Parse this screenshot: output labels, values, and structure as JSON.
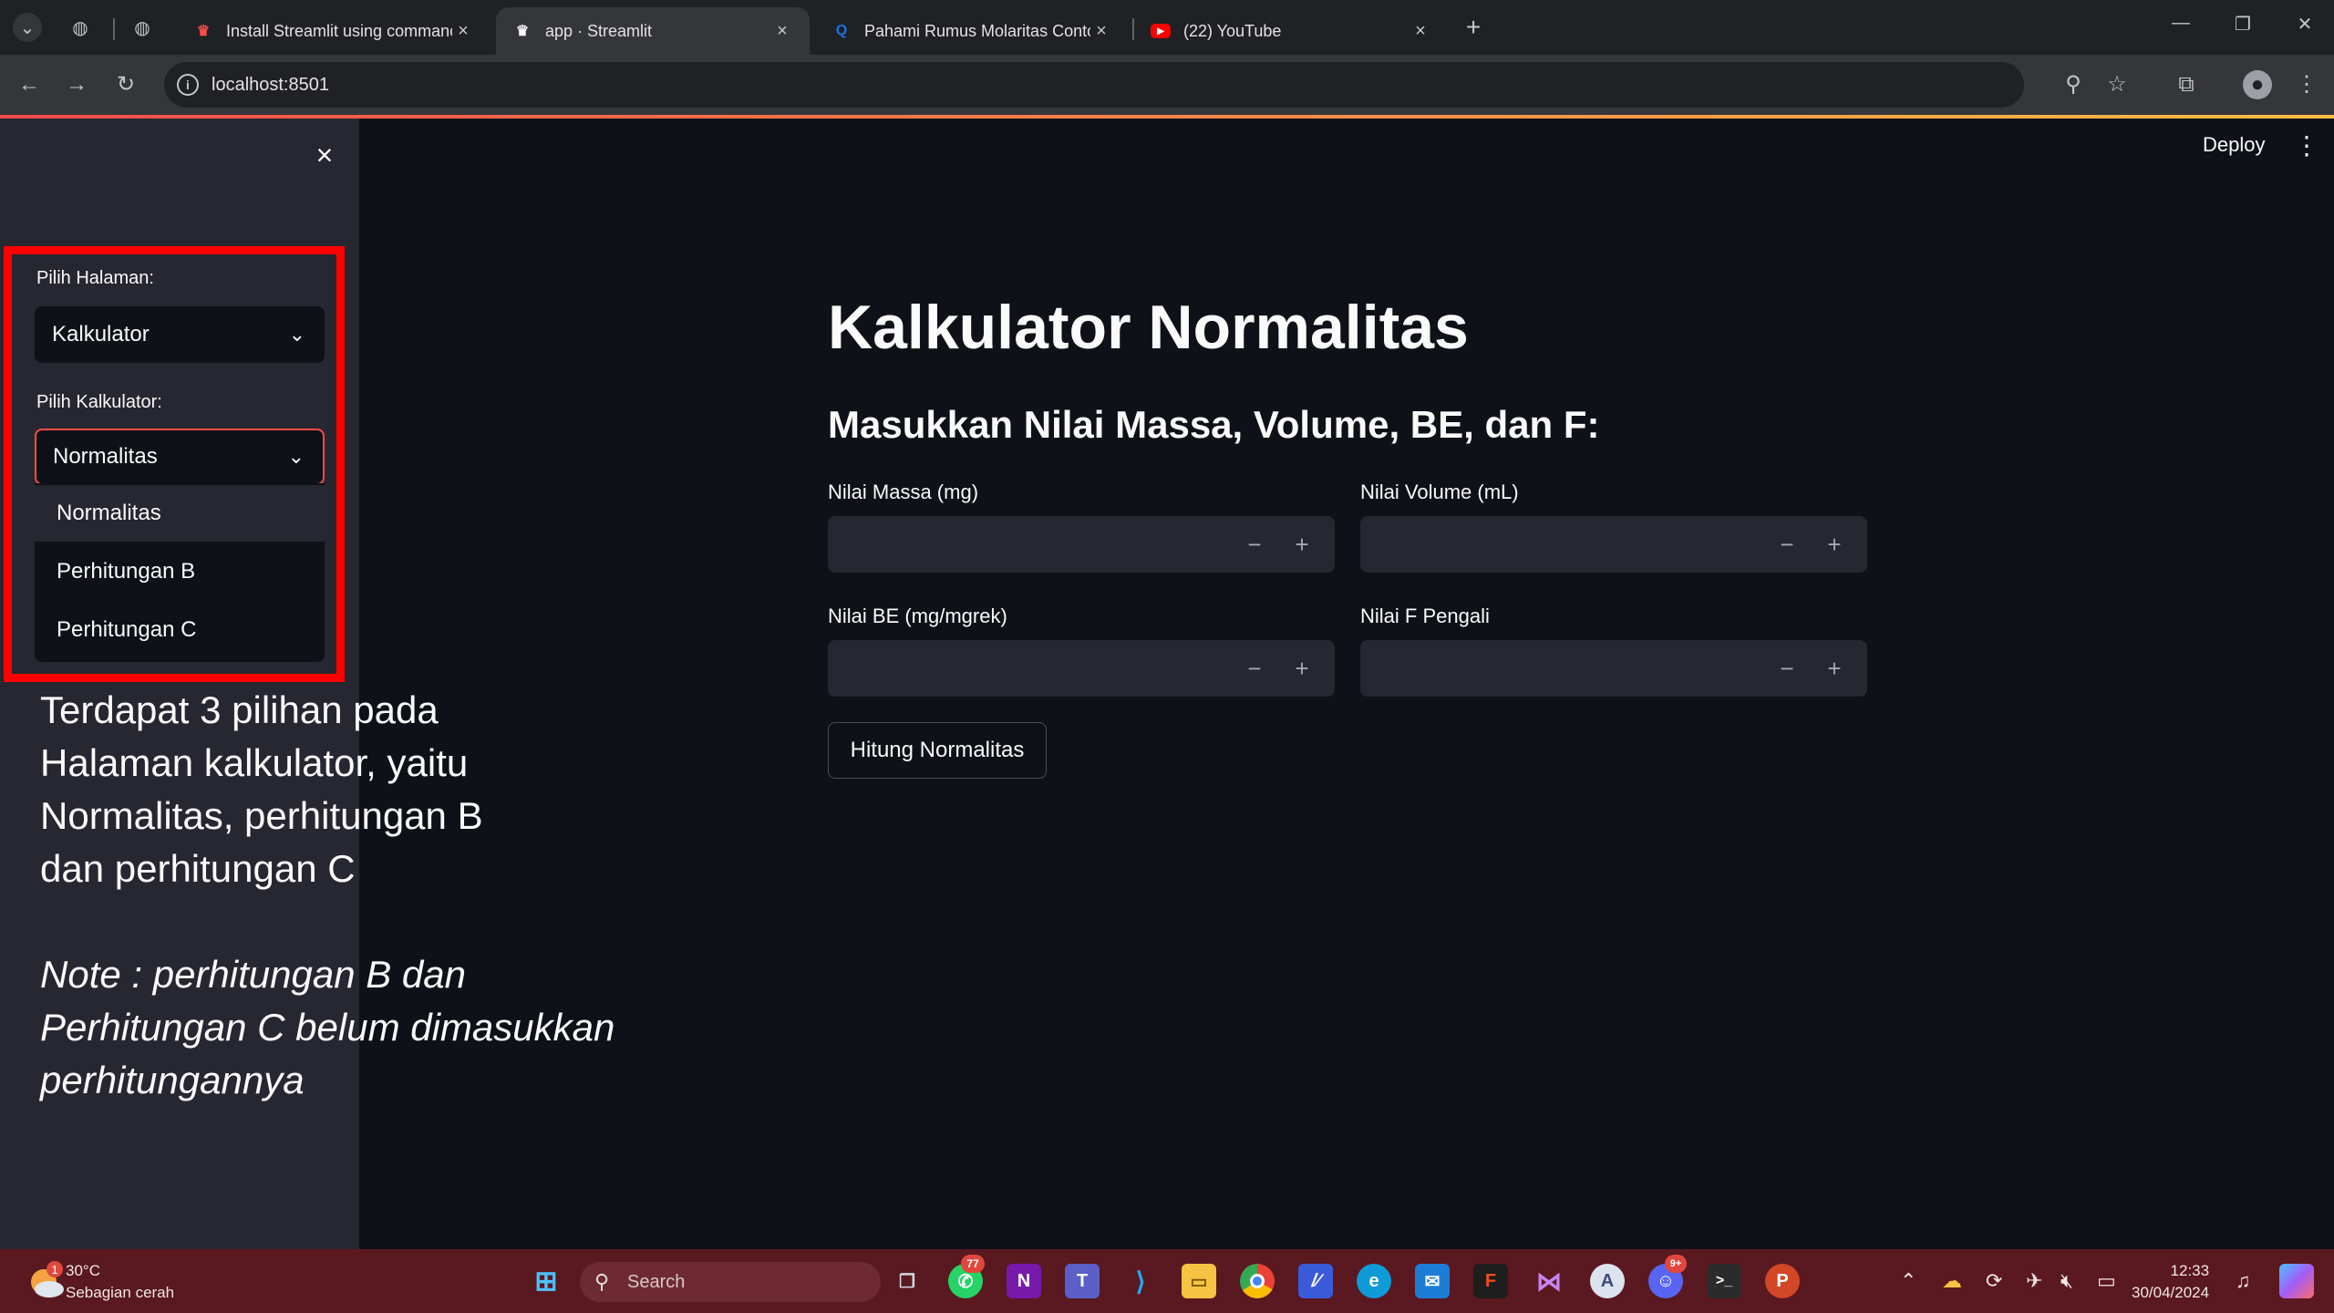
{
  "browser": {
    "tabs": [
      {
        "title": "Install Streamlit using commanc",
        "favicon": "streamlit-icon",
        "favicon_color": "#ff4b4b"
      },
      {
        "title": "app · Streamlit",
        "favicon": "streamlit-icon",
        "favicon_color": "#ff4b4b"
      },
      {
        "title": "Pahami Rumus Molaritas Conto",
        "favicon": "q-icon",
        "favicon_color": "#1a73e8"
      },
      {
        "title": "(22) YouTube",
        "favicon": "youtube-icon",
        "favicon_color": "#ff0000"
      }
    ],
    "url": "localhost:8501"
  },
  "header": {
    "deploy_label": "Deploy"
  },
  "sidebar": {
    "page_label": "Pilih Halaman:",
    "page_value": "Kalkulator",
    "calc_label": "Pilih Kalkulator:",
    "calc_value": "Normalitas",
    "calc_options": [
      "Normalitas",
      "Perhitungan B",
      "Perhitungan C"
    ]
  },
  "annotation": {
    "description_lines": [
      "Terdapat 3 pilihan pada",
      "Halaman kalkulator, yaitu",
      "Normalitas, perhitungan B",
      "dan perhitungan C"
    ],
    "note_lines": [
      "Note : perhitungan B dan",
      "Perhitungan C belum dimasukkan",
      "perhitungannya"
    ]
  },
  "main": {
    "title": "Kalkulator Normalitas",
    "subtitle": "Masukkan Nilai Massa, Volume, BE, dan F:",
    "fields": [
      {
        "label": "Nilai Massa (mg)",
        "value": ""
      },
      {
        "label": "Nilai Volume (mL)",
        "value": ""
      },
      {
        "label": "Nilai BE (mg/mgrek)",
        "value": ""
      },
      {
        "label": "Nilai F Pengali",
        "value": ""
      }
    ],
    "stepper_minus": "−",
    "stepper_plus": "+",
    "button_label": "Hitung Normalitas"
  },
  "taskbar": {
    "weather_temp": "30°C",
    "weather_desc": "Sebagian cerah",
    "weather_badge": "1",
    "search_placeholder": "Search",
    "whatsapp_badge": "77",
    "discord_badge": "9+",
    "time": "12:33",
    "date": "30/04/2024"
  }
}
